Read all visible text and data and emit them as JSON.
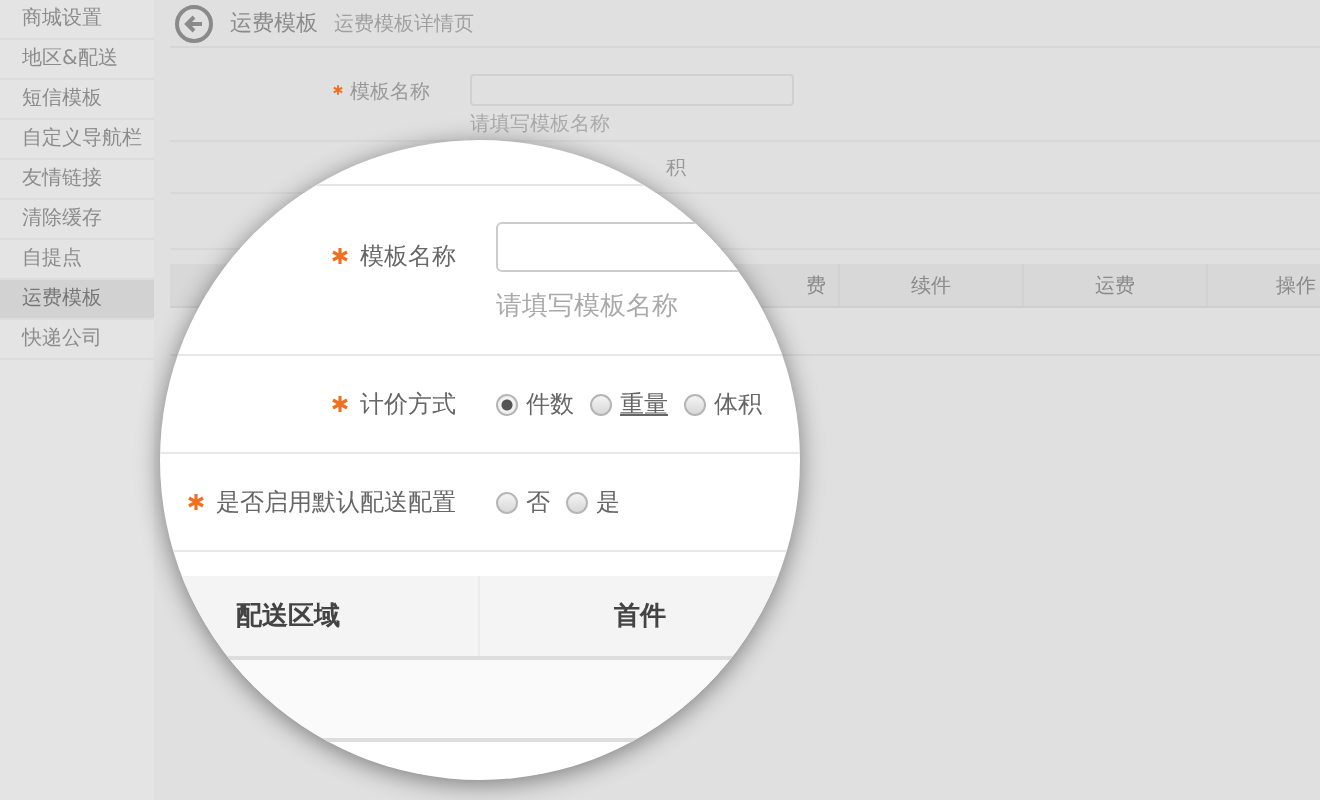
{
  "sidebar": {
    "items": [
      {
        "label": "商城设置",
        "selected": false
      },
      {
        "label": "地区&配送",
        "selected": false
      },
      {
        "label": "短信模板",
        "selected": false
      },
      {
        "label": "自定义导航栏",
        "selected": false
      },
      {
        "label": "友情链接",
        "selected": false
      },
      {
        "label": "清除缓存",
        "selected": false
      },
      {
        "label": "自提点",
        "selected": false
      },
      {
        "label": "运费模板",
        "selected": true
      },
      {
        "label": "快递公司",
        "selected": false
      }
    ]
  },
  "header": {
    "title": "运费模板",
    "subtitle": "运费模板详情页"
  },
  "background_form": {
    "label": "模板名称",
    "required": true,
    "hint": "请填写模板名称",
    "row_2_text": "积"
  },
  "background_table": {
    "columns": [
      "费",
      "续件",
      "运费",
      "操作"
    ]
  },
  "magnifier": {
    "fields": [
      {
        "kind": "text",
        "label": "模板名称",
        "required": true,
        "hint": "请填写模板名称"
      },
      {
        "kind": "radio",
        "label": "计价方式",
        "required": true,
        "options": [
          {
            "label": "件数",
            "selected": true,
            "underlined": false
          },
          {
            "label": "重量",
            "selected": false,
            "underlined": true
          },
          {
            "label": "体积",
            "selected": false,
            "underlined": false
          }
        ]
      },
      {
        "kind": "radio",
        "label": "是否启用默认配送配置",
        "required": true,
        "options": [
          {
            "label": "否",
            "selected": false,
            "underlined": false
          },
          {
            "label": "是",
            "selected": false,
            "underlined": false
          }
        ]
      }
    ],
    "table": {
      "columns": [
        "配送区域",
        "首件"
      ]
    }
  }
}
